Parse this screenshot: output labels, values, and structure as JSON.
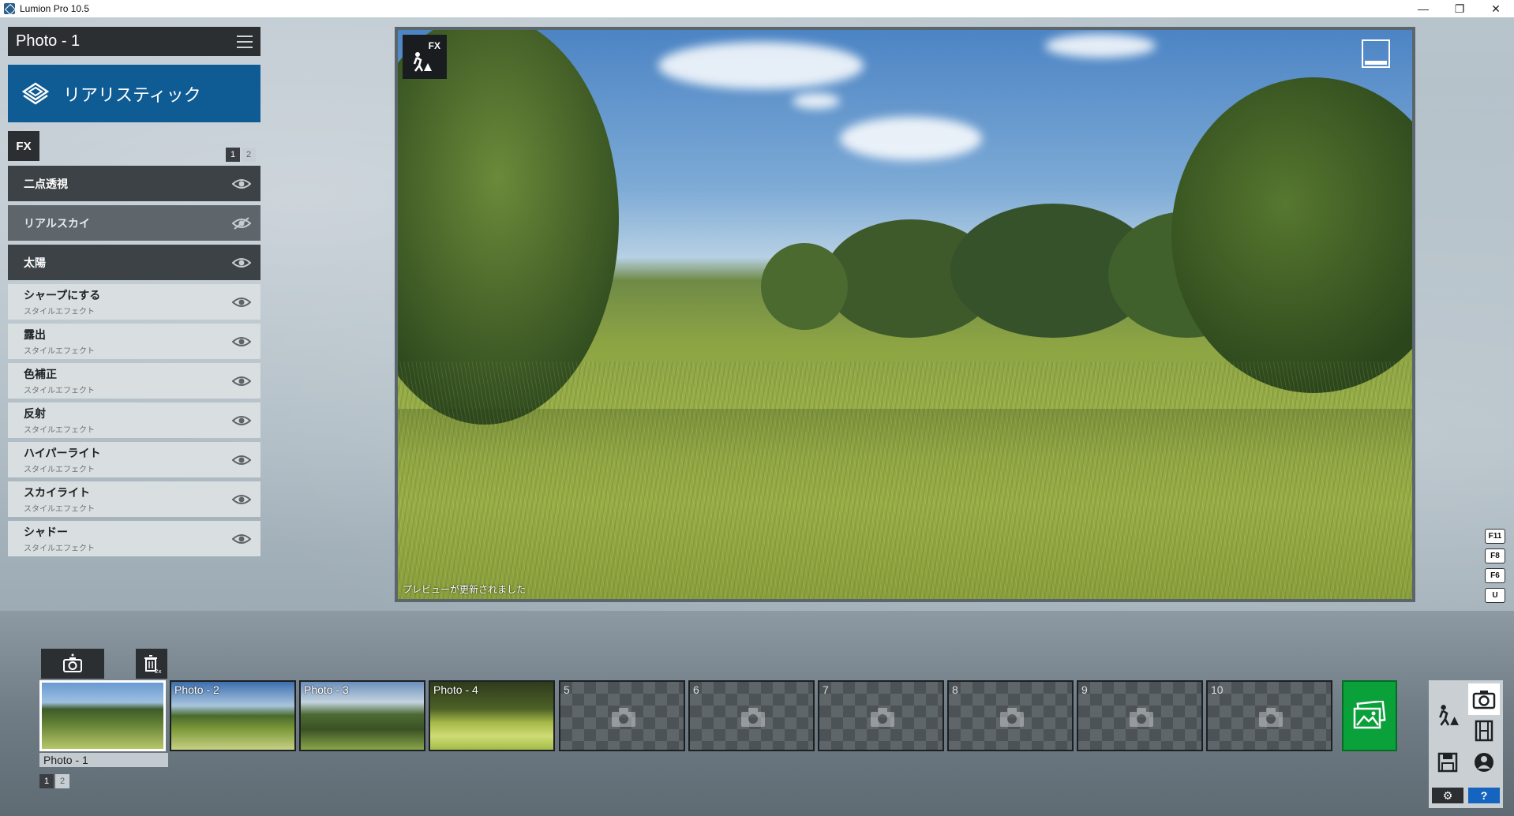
{
  "window": {
    "title": "Lumion Pro 10.5",
    "minimize": "—",
    "maximize": "❐",
    "close": "✕"
  },
  "left_panel": {
    "photo_title": "Photo - 1",
    "style_label": "リアリスティック",
    "fx_label": "FX",
    "pages": [
      "1",
      "2"
    ],
    "effects": [
      {
        "name": "二点透視",
        "sub": "",
        "visible": true
      },
      {
        "name": "リアルスカイ",
        "sub": "",
        "visible": false
      },
      {
        "name": "太陽",
        "sub": "",
        "visible": true
      },
      {
        "name": "シャープにする",
        "sub": "スタイルエフェクト",
        "visible": true
      },
      {
        "name": "露出",
        "sub": "スタイルエフェクト",
        "visible": true
      },
      {
        "name": "色補正",
        "sub": "スタイルエフェクト",
        "visible": true
      },
      {
        "name": "反射",
        "sub": "スタイルエフェクト",
        "visible": true
      },
      {
        "name": "ハイパーライト",
        "sub": "スタイルエフェクト",
        "visible": true
      },
      {
        "name": "スカイライト",
        "sub": "スタイルエフェクト",
        "visible": true
      },
      {
        "name": "シャドー",
        "sub": "スタイルエフェクト",
        "visible": true
      }
    ]
  },
  "viewport": {
    "fx_label": "FX",
    "status": "プレビューが更新されました"
  },
  "fkeys": [
    "F11",
    "F8",
    "F6",
    "U"
  ],
  "filmstrip": {
    "thumbnails": [
      {
        "label": "",
        "kind": "photo1"
      },
      {
        "label": "Photo - 2",
        "kind": "photo2"
      },
      {
        "label": "Photo - 3",
        "kind": "photo3"
      },
      {
        "label": "Photo - 4",
        "kind": "photo4"
      },
      {
        "label": "5",
        "kind": "empty"
      },
      {
        "label": "6",
        "kind": "empty"
      },
      {
        "label": "7",
        "kind": "empty"
      },
      {
        "label": "8",
        "kind": "empty"
      },
      {
        "label": "9",
        "kind": "empty"
      },
      {
        "label": "10",
        "kind": "empty"
      }
    ],
    "selected_caption": "Photo - 1",
    "pages": [
      "1",
      "2"
    ],
    "delete_badge": "2x"
  },
  "mode_panel": {
    "help_label": "?",
    "settings_label": "⚙"
  },
  "colors": {
    "accent_blue": "#0f5b94",
    "render_green": "#0aa03a",
    "panel_dark": "#2c2f32"
  }
}
